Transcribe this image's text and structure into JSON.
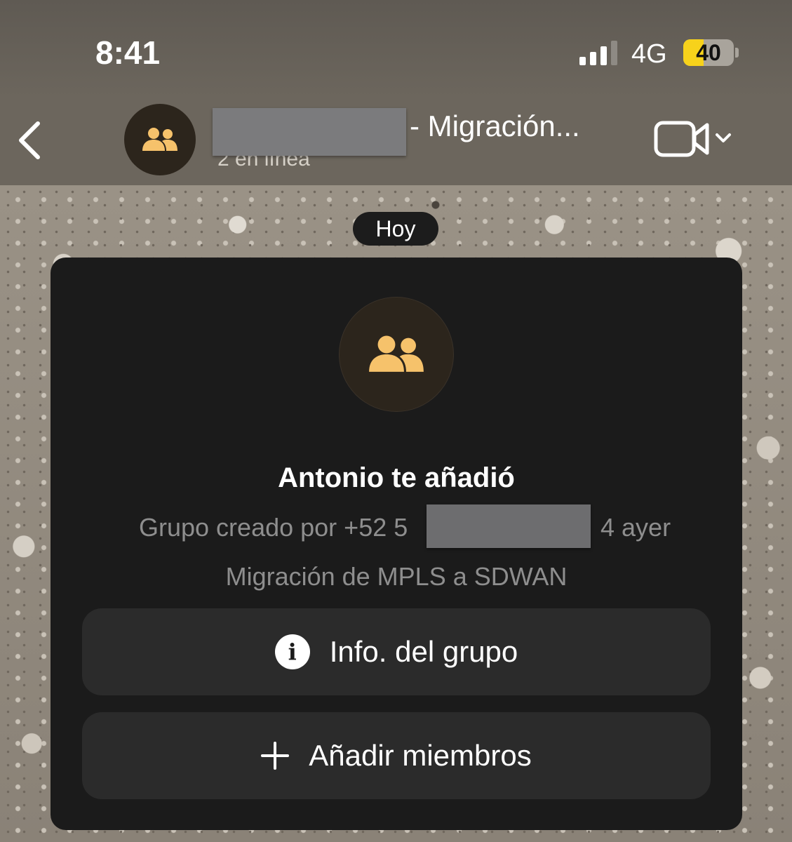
{
  "status_bar": {
    "time": "8:41",
    "network": "4G",
    "battery_level": "40",
    "battery_fraction": 0.4,
    "battery_color": "#f7d21b"
  },
  "header": {
    "title_visible": "- Migración...",
    "subtitle": "2 en línea",
    "back_icon": "chevron-left-icon",
    "video_icon": "video-camera-icon"
  },
  "date_divider": "Hoy",
  "system_card": {
    "avatar_icon": "group-icon",
    "icon_color": "#f6c26b",
    "added_by": "Antonio te añadió",
    "created_prefix": "Grupo creado por +52 5",
    "created_suffix": "4 ayer",
    "description": "Migración de MPLS a SDWAN",
    "info_button_label": "Info. del grupo",
    "add_members_label": "Añadir miembros"
  }
}
